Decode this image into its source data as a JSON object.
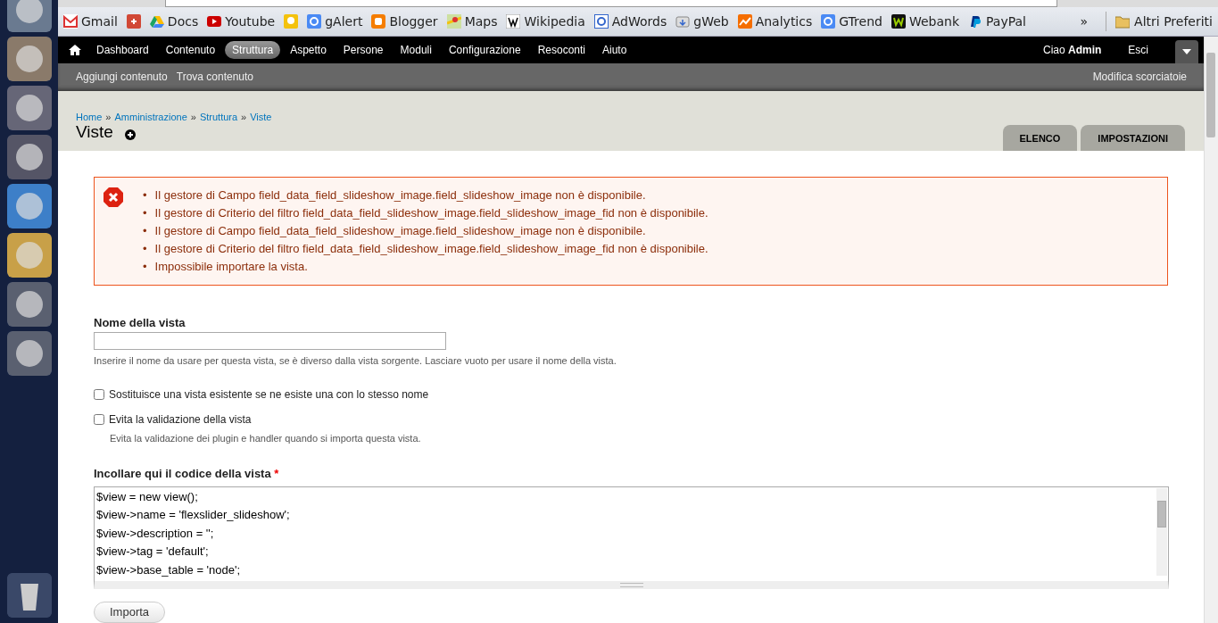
{
  "bookmarks": [
    {
      "label": "Gmail",
      "kind": "mail"
    },
    {
      "kind": "gplus"
    },
    {
      "label": "Docs",
      "kind": "drive"
    },
    {
      "label": "Youtube",
      "kind": "video"
    },
    {
      "kind": "bulb"
    },
    {
      "label": "gAlert",
      "kind": "gsquare"
    },
    {
      "label": "Blogger",
      "kind": "blogger"
    },
    {
      "label": "Maps",
      "kind": "map"
    },
    {
      "label": "Wikipedia",
      "kind": "wiki"
    },
    {
      "label": "AdWords",
      "kind": "goutline"
    },
    {
      "label": "gWeb",
      "kind": "download"
    },
    {
      "label": "Analytics",
      "kind": "chart"
    },
    {
      "label": "GTrend",
      "kind": "gsquare"
    },
    {
      "label": "Webank",
      "kind": "wbox"
    },
    {
      "label": "PayPal",
      "kind": "paypal"
    }
  ],
  "bookmarks_more": "»",
  "other_bookmarks": "Altri Preferiti",
  "toolbar": {
    "items": [
      {
        "label": "Dashboard",
        "selected": false
      },
      {
        "label": "Contenuto",
        "selected": false
      },
      {
        "label": "Struttura",
        "selected": true
      },
      {
        "label": "Aspetto",
        "selected": false
      },
      {
        "label": "Persone",
        "selected": false
      },
      {
        "label": "Moduli",
        "selected": false
      },
      {
        "label": "Configurazione",
        "selected": false
      },
      {
        "label": "Resoconti",
        "selected": false
      },
      {
        "label": "Aiuto",
        "selected": false
      }
    ],
    "greeting": "Ciao **Admin**",
    "logout": "Esci"
  },
  "shortcuts": {
    "items": [
      "Aggiungi contenuto",
      "Trova contenuto"
    ],
    "edit": "Modifica scorciatoie"
  },
  "breadcrumb": {
    "items": [
      "Home",
      "Amministrazione",
      "Struttura",
      "Viste"
    ],
    "separators": [
      "»",
      "»",
      "»"
    ]
  },
  "title": "Viste",
  "tabs": [
    {
      "label": "ELENCO",
      "selected": false
    },
    {
      "label": "IMPOSTAZIONI",
      "selected": false
    }
  ],
  "messages": {
    "items": [
      {
        "marker": "•",
        "text": "Il gestore di Campo field_data_field_slideshow_image.field_slideshow_image non è disponibile."
      },
      {
        "marker": "•",
        "text": "Il gestore di Criterio del filtro field_data_field_slideshow_image.field_slideshow_image_fid non è disponibile."
      },
      {
        "marker": "•",
        "text": "Il gestore di Campo field_data_field_slideshow_image.field_slideshow_image non è disponibile."
      },
      {
        "marker": "•",
        "text": "Il gestore di Criterio del filtro field_data_field_slideshow_image.field_slideshow_image_fid non è disponibile."
      },
      {
        "marker": "•",
        "text": "Impossibile importare la vista."
      }
    ]
  },
  "form": {
    "name_label": "Nome della vista",
    "name_description": "Inserire il nome da usare per questa vista, se è diverso dalla vista sorgente. Lasciare vuoto per usare il nome della vista.",
    "checkboxes": [
      {
        "label": "Sostituisce una vista esistente se ne esiste una con lo stesso nome",
        "checked": false
      },
      {
        "label": "Evita la validazione della vista",
        "checked": false,
        "description": "Evita la validazione dei plugin e handler quando si importa questa vista."
      }
    ],
    "code_label": "Incollare qui il codice della vista",
    "code_required": true,
    "required_mark": "*",
    "code_lines": [
      "$view = new view();",
      "$view->name = 'flexslider_slideshow';",
      "$view->description = '';",
      "$view->tag = 'default';",
      "$view->base_table = 'node';"
    ],
    "submit": "Importa"
  }
}
